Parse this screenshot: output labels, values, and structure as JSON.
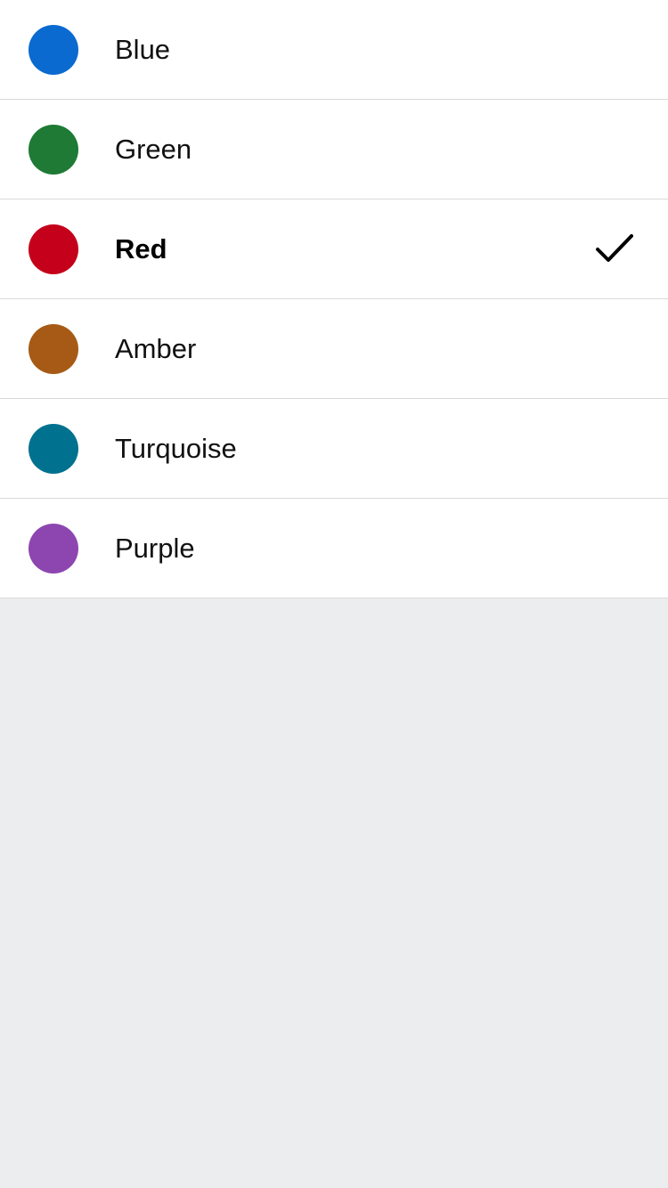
{
  "colors": [
    {
      "label": "Blue",
      "swatch": "#0A6AD0",
      "selected": false
    },
    {
      "label": "Green",
      "swatch": "#1E7A34",
      "selected": false
    },
    {
      "label": "Red",
      "swatch": "#C5001A",
      "selected": true
    },
    {
      "label": "Amber",
      "swatch": "#A65A15",
      "selected": false
    },
    {
      "label": "Turquoise",
      "swatch": "#00718F",
      "selected": false
    },
    {
      "label": "Purple",
      "swatch": "#8D46B0",
      "selected": false
    }
  ],
  "icons": {
    "checkmark": "checkmark-icon"
  }
}
